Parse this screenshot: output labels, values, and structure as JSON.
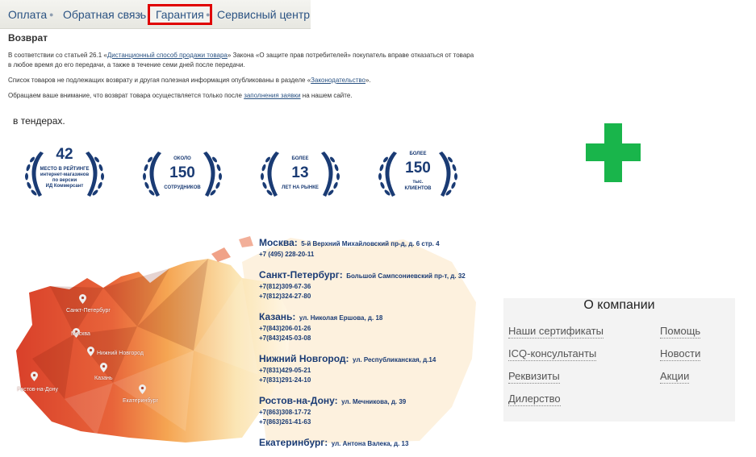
{
  "nav": {
    "items": [
      "Оплата",
      "Обратная связь",
      "Гарантия",
      "Сервисный центр"
    ],
    "active": "Гарантия"
  },
  "policy": {
    "title": "Возврат",
    "p1_before": "В соответствии со статьей 26.1 «",
    "p1_link": "Дистанционный способ продажи товара",
    "p1_after": "» Закона «О защите прав потребителей» покупатель вправе отказаться от товара в любое время до его передачи, а также в течение семи дней после передачи.",
    "p2_before": "Список товаров не подлежащих возврату и другая полезная информация опубликованы в разделе «",
    "p2_link": "Законодательство",
    "p2_after": "».",
    "p3_before": "Обращаем ваше внимание, что возврат товара осуществляется только после ",
    "p3_link": "заполнения заявки",
    "p3_after": " на нашем сайте."
  },
  "tenders_text": "в тендерах.",
  "badges": [
    {
      "top": "",
      "number": "42",
      "bottom1": "МЕСТО В РЕЙТИНГЕ",
      "bottom2": "интернет-магазинов",
      "bottom3": "по версии",
      "bottom4": "ИД Коммерсант"
    },
    {
      "top": "ОКОЛО",
      "number": "150",
      "bottom1": "СОТРУДНИКОВ",
      "bottom2": "",
      "bottom3": "",
      "bottom4": ""
    },
    {
      "top": "БОЛЕЕ",
      "number": "13",
      "bottom1": "ЛЕТ НА РЫНКЕ",
      "bottom2": "",
      "bottom3": "",
      "bottom4": ""
    },
    {
      "top": "БОЛЕЕ",
      "number": "150",
      "bottom1": "тыс.",
      "bottom2": "КЛИЕНТОВ",
      "bottom3": "",
      "bottom4": ""
    }
  ],
  "map_pins": [
    "Санкт-Петербург",
    "Москва",
    "Нижний Новгород",
    "Казань",
    "Ростов-на-Дону",
    "Екатеринбург"
  ],
  "offices": [
    {
      "city": "Москва:",
      "street": "5-й Верхний Михайловский пр-д, д. 6 стр. 4",
      "phones": [
        "+7 (495) 228-20-11"
      ]
    },
    {
      "city": "Санкт-Петербург:",
      "street": "Большой Сампсониевский пр-т, д. 32",
      "phones": [
        "+7(812)309-67-36",
        "+7(812)324-27-80"
      ]
    },
    {
      "city": "Казань:",
      "street": "ул. Николая Ершова, д. 18",
      "phones": [
        "+7(843)206-01-26",
        "+7(843)245-03-08"
      ]
    },
    {
      "city": "Нижний Новгород:",
      "street": "ул. Республиканская, д.14",
      "phones": [
        "+7(831)429-05-21",
        "+7(831)291-24-10"
      ]
    },
    {
      "city": "Ростов-на-Дону:",
      "street": "ул. Мечникова, д. 39",
      "phones": [
        "+7(863)308-17-72",
        "+7(863)261-41-63"
      ]
    },
    {
      "city": "Екатеринбург:",
      "street": "ул. Антона Валека, д. 13",
      "phones": []
    }
  ],
  "about": {
    "title": "О компании",
    "left_links": [
      "Наши сертификаты",
      "ICQ-консультанты",
      "Реквизиты",
      "Дилерство"
    ],
    "right_links": [
      "Помощь",
      "Новости",
      "Акции"
    ]
  },
  "colors": {
    "accent": "#2b5383",
    "active_border": "#e00000",
    "badge": "#1a3b74",
    "cross": "#19b54b",
    "map": "#e0553a"
  },
  "icons": [
    "laurel-wreath-icon",
    "map-pin-icon",
    "plus-cross-icon"
  ]
}
